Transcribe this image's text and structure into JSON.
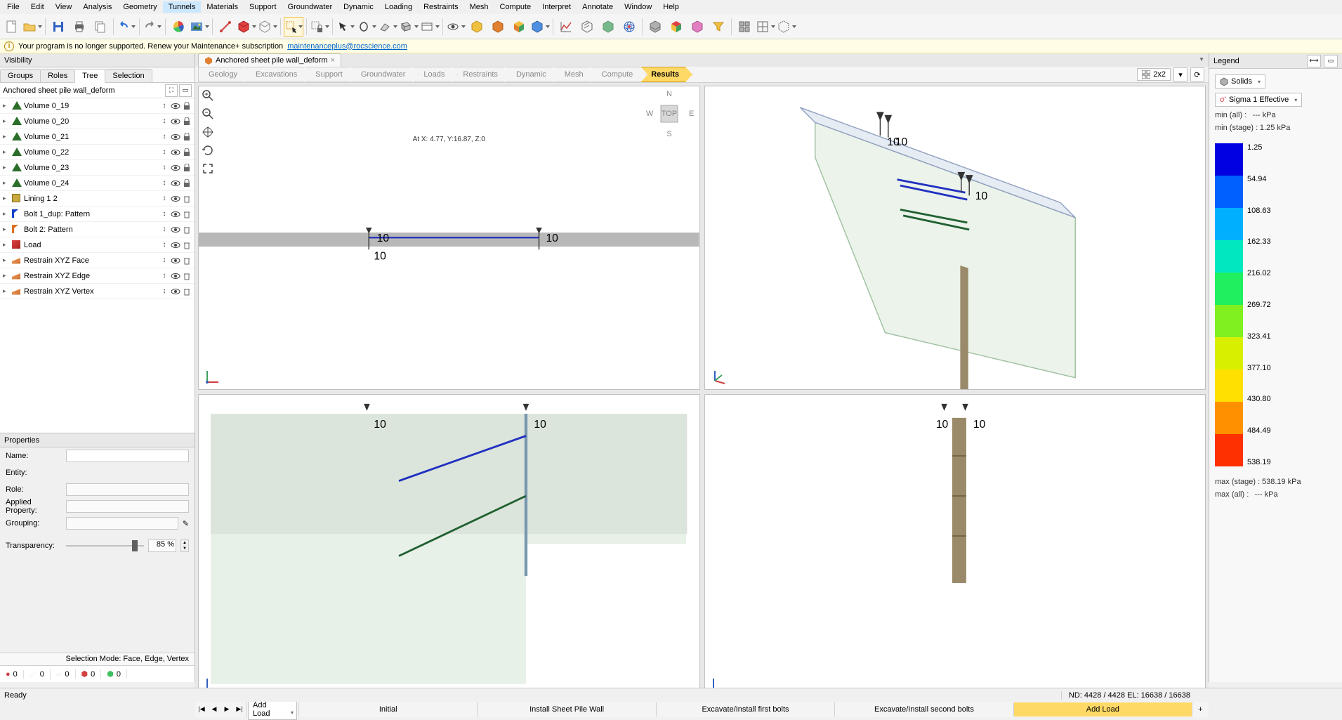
{
  "menu": [
    "File",
    "Edit",
    "View",
    "Analysis",
    "Geometry",
    "Tunnels",
    "Materials",
    "Support",
    "Groundwater",
    "Dynamic",
    "Loading",
    "Restraints",
    "Mesh",
    "Compute",
    "Interpret",
    "Annotate",
    "Window",
    "Help"
  ],
  "menu_highlight": 5,
  "notification": {
    "text": "Your program is no longer supported. Renew your Maintenance+ subscription",
    "link": "maintenanceplus@rocscience.com"
  },
  "visibility": {
    "title": "Visibility",
    "tabs": [
      "Groups",
      "Roles",
      "Tree",
      "Selection"
    ],
    "active_tab": 2,
    "tree_title": "Anchored sheet pile wall_deform",
    "items": [
      {
        "label": "Volume 0_19",
        "icon": "tri",
        "ctl": "eye-lock"
      },
      {
        "label": "Volume 0_20",
        "icon": "tri",
        "ctl": "eye-lock"
      },
      {
        "label": "Volume 0_21",
        "icon": "tri",
        "ctl": "eye-lock"
      },
      {
        "label": "Volume 0_22",
        "icon": "tri",
        "ctl": "eye-lock"
      },
      {
        "label": "Volume 0_23",
        "icon": "tri",
        "ctl": "eye-lock"
      },
      {
        "label": "Volume 0_24",
        "icon": "tri",
        "ctl": "eye-lock"
      },
      {
        "label": "Lining 1 2",
        "icon": "sq",
        "ctl": "eye-del"
      },
      {
        "label": "Bolt 1_dup: Pattern",
        "icon": "flag-b",
        "ctl": "eye-del"
      },
      {
        "label": "Bolt 2: Pattern",
        "icon": "flag-o",
        "ctl": "eye-del"
      },
      {
        "label": "Load",
        "icon": "cube-r",
        "ctl": "eye-del"
      },
      {
        "label": "Restrain XYZ Face",
        "icon": "wedge",
        "ctl": "eye-del"
      },
      {
        "label": "Restrain XYZ Edge",
        "icon": "wedge",
        "ctl": "eye-del"
      },
      {
        "label": "Restrain XYZ Vertex",
        "icon": "wedge",
        "ctl": "eye-del"
      }
    ]
  },
  "properties": {
    "title": "Properties",
    "name_label": "Name:",
    "entity_label": "Entity:",
    "role_label": "Role:",
    "applied_label": "Applied Property:",
    "grouping_label": "Grouping:",
    "transparency_label": "Transparency:",
    "transparency_value": "85 %"
  },
  "selection_mode": "Selection Mode: Face, Edge, Vertex",
  "counters": [
    {
      "color": "#d04040",
      "val": "0"
    },
    {
      "color": "#e8e8e0",
      "val": "0"
    },
    {
      "color": "#e8e8e0",
      "val": "0"
    },
    {
      "color": "#d04040",
      "val": "0"
    },
    {
      "color": "#40c060",
      "val": "0"
    }
  ],
  "doc_tab": "Anchored sheet pile wall_deform",
  "breadcrumbs": [
    "Geology",
    "Excavations",
    "Support",
    "Groundwater",
    "Loads",
    "Restraints",
    "Dynamic",
    "Mesh",
    "Compute",
    "Results"
  ],
  "bc_active": 9,
  "view_layout": "2x2",
  "coord_text": "At X: 4.77, Y:16.87, Z:0",
  "compass": {
    "n": "N",
    "e": "E",
    "s": "S",
    "w": "W",
    "top": "TOP"
  },
  "stages": [
    "Initial",
    "Install Sheet Pile Wall",
    "Excavate/Install first bolts",
    "Excavate/Install second bolts",
    "Add Load"
  ],
  "stage_active": 4,
  "stage_current": "Add Load",
  "legend": {
    "title": "Legend",
    "solids": "Solids",
    "sigma": "Sigma 1 Effective",
    "min_all_label": "min (all) :",
    "min_all_val": "--- kPa",
    "min_stage_label": "min (stage) :",
    "min_stage_val": "1.25 kPa",
    "max_stage_label": "max (stage) :",
    "max_stage_val": "538.19 kPa",
    "max_all_label": "max (all) :",
    "max_all_val": "--- kPa",
    "stops": [
      "1.25",
      "54.94",
      "108.63",
      "162.33",
      "216.02",
      "269.72",
      "323.41",
      "377.10",
      "430.80",
      "484.49",
      "538.19"
    ]
  },
  "status": {
    "ready": "Ready",
    "nd": "ND: 4428 / 4428  EL: 16638 / 16638"
  },
  "viewport_label_10": "10"
}
